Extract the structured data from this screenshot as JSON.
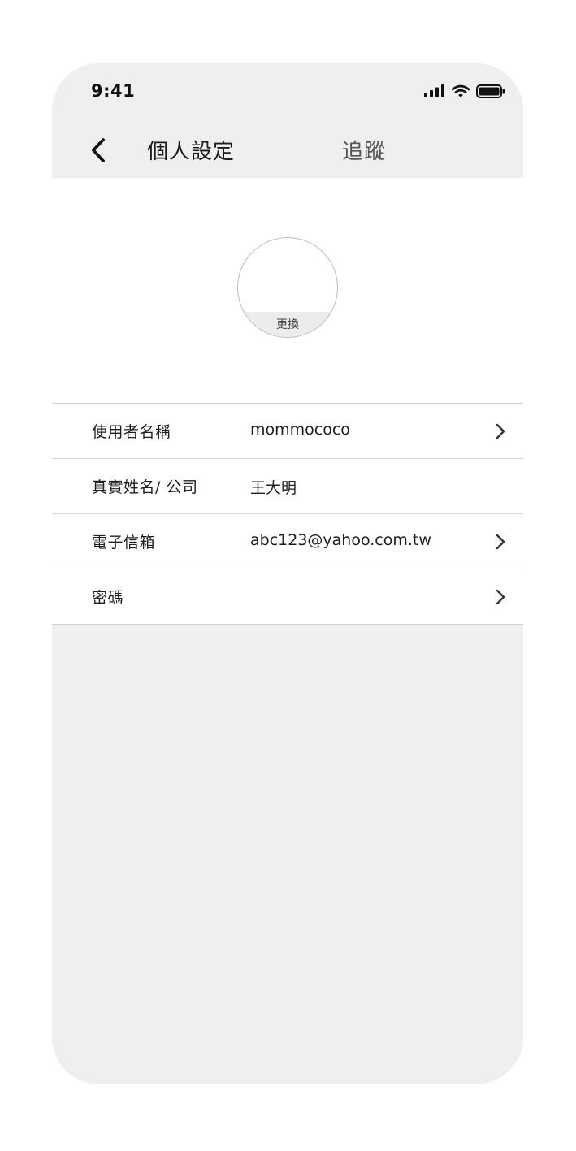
{
  "status_bar": {
    "time": "9:41"
  },
  "nav": {
    "back_icon": "chevron-left-icon",
    "title": "個人設定",
    "follow_label": "追蹤"
  },
  "avatar": {
    "change_label": "更換"
  },
  "settings": {
    "rows": [
      {
        "label": "使用者名稱",
        "value": "mommococo",
        "has_chevron": true
      },
      {
        "label": "真實姓名/ 公司",
        "value": "王大明",
        "has_chevron": false
      },
      {
        "label": "電子信箱",
        "value": "abc123@yahoo.com.tw",
        "has_chevron": true
      },
      {
        "label": "密碼",
        "value": "",
        "has_chevron": true
      }
    ]
  },
  "colors": {
    "background": "#efefef",
    "surface": "#ffffff",
    "divider": "#d4d4d4",
    "text_primary": "#1e1e1e",
    "text_secondary": "#555555"
  },
  "icons": {
    "signal": "cellular-signal-icon",
    "wifi": "wifi-icon",
    "battery": "battery-icon",
    "chevron": "chevron-right-icon"
  }
}
